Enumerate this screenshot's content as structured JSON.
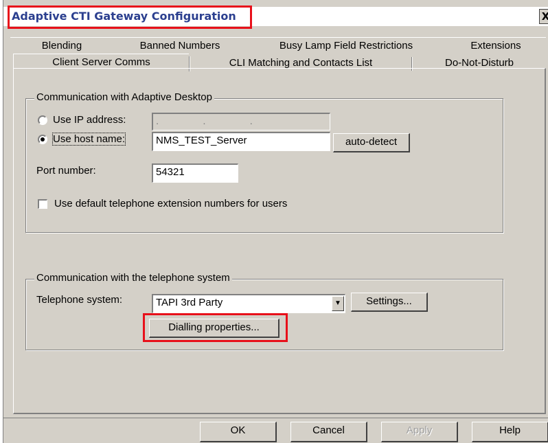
{
  "window": {
    "title": "Adaptive CTI Gateway Configuration",
    "close_glyph": "X"
  },
  "tabs": {
    "back_row": [
      "Blending",
      "Banned Numbers",
      "Busy Lamp Field Restrictions",
      "Extensions"
    ],
    "front_row": [
      "Client Server Comms",
      "CLI Matching and Contacts List",
      "Do-Not-Disturb"
    ],
    "active": "Client Server Comms"
  },
  "desktop_group": {
    "title": "Communication with Adaptive Desktop",
    "use_ip_label": "Use IP address:",
    "ip_value": ". . .",
    "use_host_label": "Use host name:",
    "host_value": "NMS_TEST_Server",
    "auto_detect_label": "auto-detect",
    "port_label": "Port number:",
    "port_value": "54321",
    "default_ext_label": "Use default telephone extension numbers for users",
    "selected_option": "Use host name"
  },
  "telephone_group": {
    "title": "Communication with the telephone system",
    "system_label": "Telephone system:",
    "system_value": "TAPI 3rd Party",
    "settings_label": "Settings...",
    "dialling_label": "Dialling properties..."
  },
  "footer": {
    "ok_label": "OK",
    "cancel_label": "Cancel",
    "apply_label": "Apply",
    "help_label": "Help"
  },
  "colors": {
    "annotation_red": "#e8101a",
    "title_blue": "#2b3f8f",
    "dialog_gray": "#d4d0c8"
  }
}
